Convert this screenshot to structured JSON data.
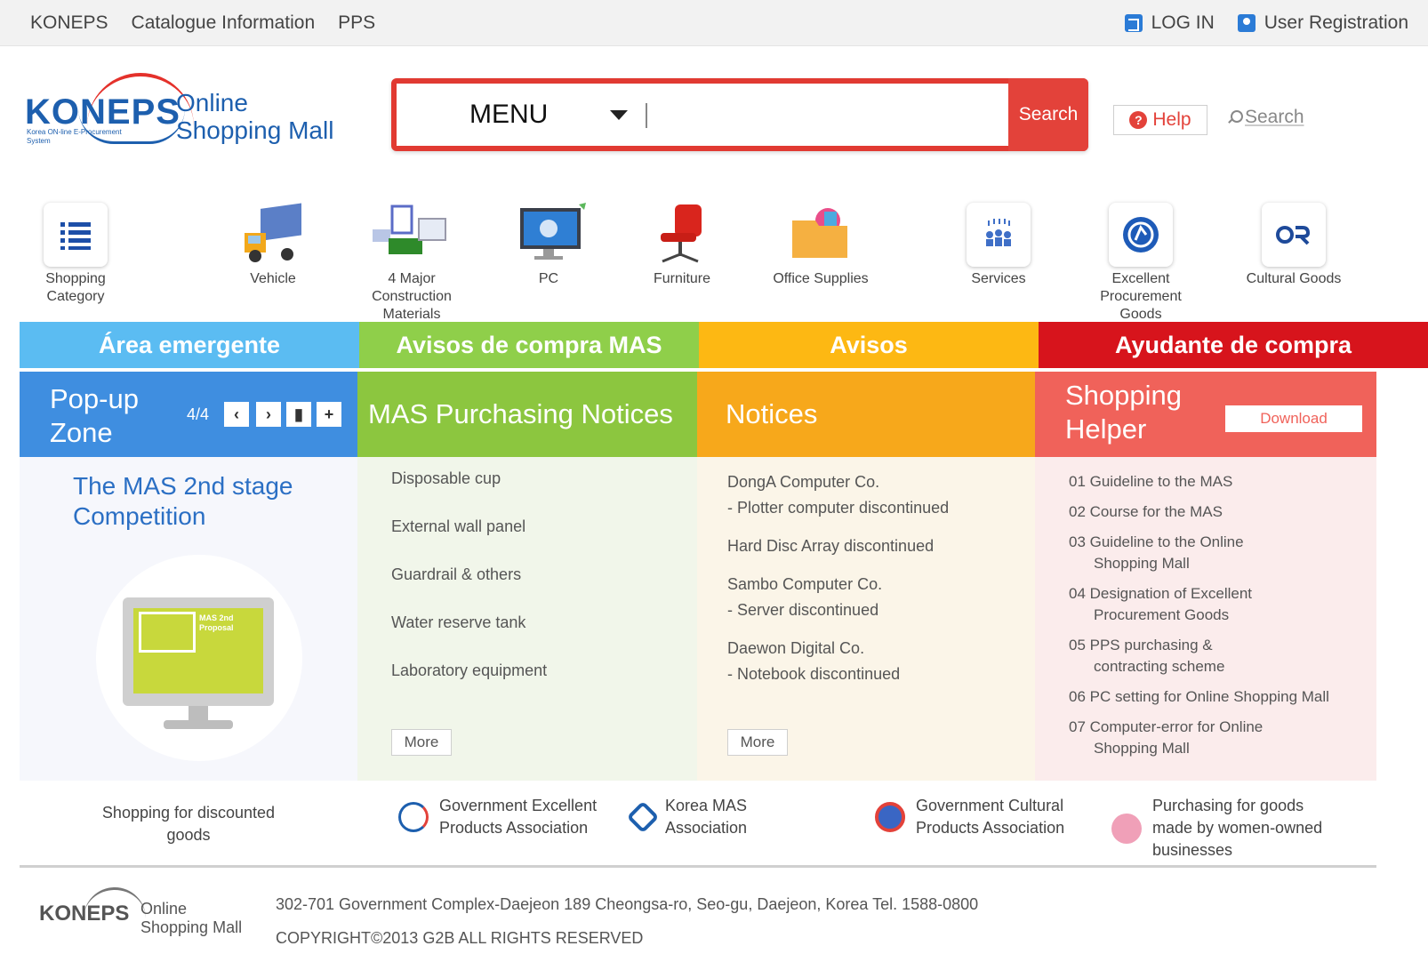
{
  "topbar": {
    "nav": [
      "KONEPS",
      "Catalogue Information",
      "PPS"
    ],
    "login": "LOG IN",
    "register": "User Registration"
  },
  "logo": {
    "brand": "KONEPS",
    "line1": "Online",
    "line2": "Shopping Mall",
    "small": "Korea ON-line E-Procurement System"
  },
  "search": {
    "menu_label": "MENU",
    "placeholder": "",
    "button": "Search",
    "help": "Help",
    "search_link": "Search"
  },
  "categories": [
    {
      "label": "Shopping Category"
    },
    {
      "label": "Vehicle"
    },
    {
      "label": "4 Major Construction Materials"
    },
    {
      "label": "PC"
    },
    {
      "label": "Furniture"
    },
    {
      "label": "Office Supplies"
    },
    {
      "label": "Services"
    },
    {
      "label": "Excellent Procurement Goods"
    },
    {
      "label": "Cultural Goods"
    }
  ],
  "band": [
    {
      "label": "Área emergente",
      "color": "#5bbcf2"
    },
    {
      "label": "Avisos de compra MAS",
      "color": "#8fcf4a"
    },
    {
      "label": "Avisos",
      "color": "#fdb813"
    },
    {
      "label": "Ayudante de compra",
      "color": "#d7141c"
    }
  ],
  "popup": {
    "title": "Pop-up Zone",
    "pager": "4/4",
    "promo": "The MAS 2nd stage Competition",
    "screen_text": "MAS 2nd Proposal"
  },
  "mas": {
    "title": "MAS Purchasing Notices",
    "items": [
      "Disposable cup",
      "External wall panel",
      "Guardrail & others",
      "Water reserve tank",
      "Laboratory equipment"
    ],
    "more": "More"
  },
  "notices": {
    "title": "Notices",
    "items": [
      {
        "main": "DongA Computer Co.",
        "sub": "- Plotter computer discontinued"
      },
      {
        "main": "Hard Disc Array discontinued",
        "sub": ""
      },
      {
        "main": "Sambo Computer Co.",
        "sub": "- Server discontinued"
      },
      {
        "main": "Daewon Digital Co.",
        "sub": "- Notebook discontinued"
      }
    ],
    "more": "More"
  },
  "helper": {
    "title": "Shopping Helper",
    "download": "Download",
    "items": [
      {
        "a": "01 Guideline to the MAS",
        "b": ""
      },
      {
        "a": "02 Course for the MAS",
        "b": ""
      },
      {
        "a": "03 Guideline to the Online",
        "b": "Shopping Mall"
      },
      {
        "a": "04 Designation of Excellent",
        "b": "Procurement Goods"
      },
      {
        "a": "05 PPS purchasing &",
        "b": "contracting scheme"
      },
      {
        "a": "06 PC setting for Online Shopping Mall",
        "b": ""
      },
      {
        "a": "07 Computer-error for Online",
        "b": "Shopping Mall"
      }
    ]
  },
  "partners": [
    {
      "text": "Shopping for discounted goods"
    },
    {
      "text": "Government Excellent Products Association"
    },
    {
      "text": "Korea MAS Association"
    },
    {
      "text": "Government Cultural Products Association"
    },
    {
      "text": "Purchasing for goods made by women-owned businesses"
    }
  ],
  "footer": {
    "brand": "KONEPS",
    "line1": "Online",
    "line2": "Shopping Mall",
    "address": "302-701 Government Complex-Daejeon 189 Cheongsa-ro, Seo-gu, Daejeon, Korea Tel. 1588-0800",
    "copyright": "COPYRIGHT©2013 G2B ALL RIGHTS RESERVED"
  }
}
